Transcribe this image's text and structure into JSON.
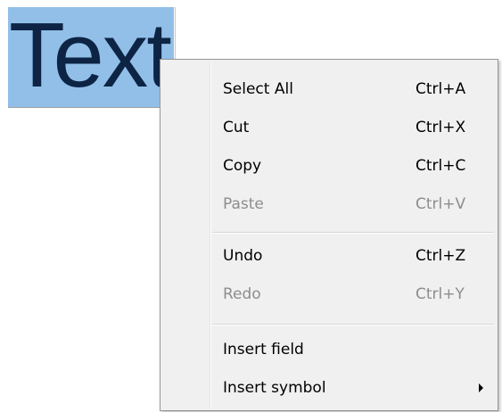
{
  "editor": {
    "selected_text": "Text"
  },
  "context_menu": {
    "items": [
      {
        "label": "Select All",
        "shortcut": "Ctrl+A",
        "enabled": true
      },
      {
        "label": "Cut",
        "shortcut": "Ctrl+X",
        "enabled": true
      },
      {
        "label": "Copy",
        "shortcut": "Ctrl+C",
        "enabled": true
      },
      {
        "label": "Paste",
        "shortcut": "Ctrl+V",
        "enabled": false
      },
      {
        "label": "Undo",
        "shortcut": "Ctrl+Z",
        "enabled": true
      },
      {
        "label": "Redo",
        "shortcut": "Ctrl+Y",
        "enabled": false
      },
      {
        "label": "Insert field",
        "shortcut": "",
        "enabled": true
      },
      {
        "label": "Insert symbol",
        "shortcut": "",
        "enabled": true,
        "has_submenu": true,
        "submenu_icon": "chevron-right-icon"
      }
    ]
  },
  "colors": {
    "selection_highlight": "#91bfe8",
    "selected_text_color": "#0d2444",
    "menu_background": "#f0f0f0",
    "disabled_text": "#8d8d8d"
  }
}
